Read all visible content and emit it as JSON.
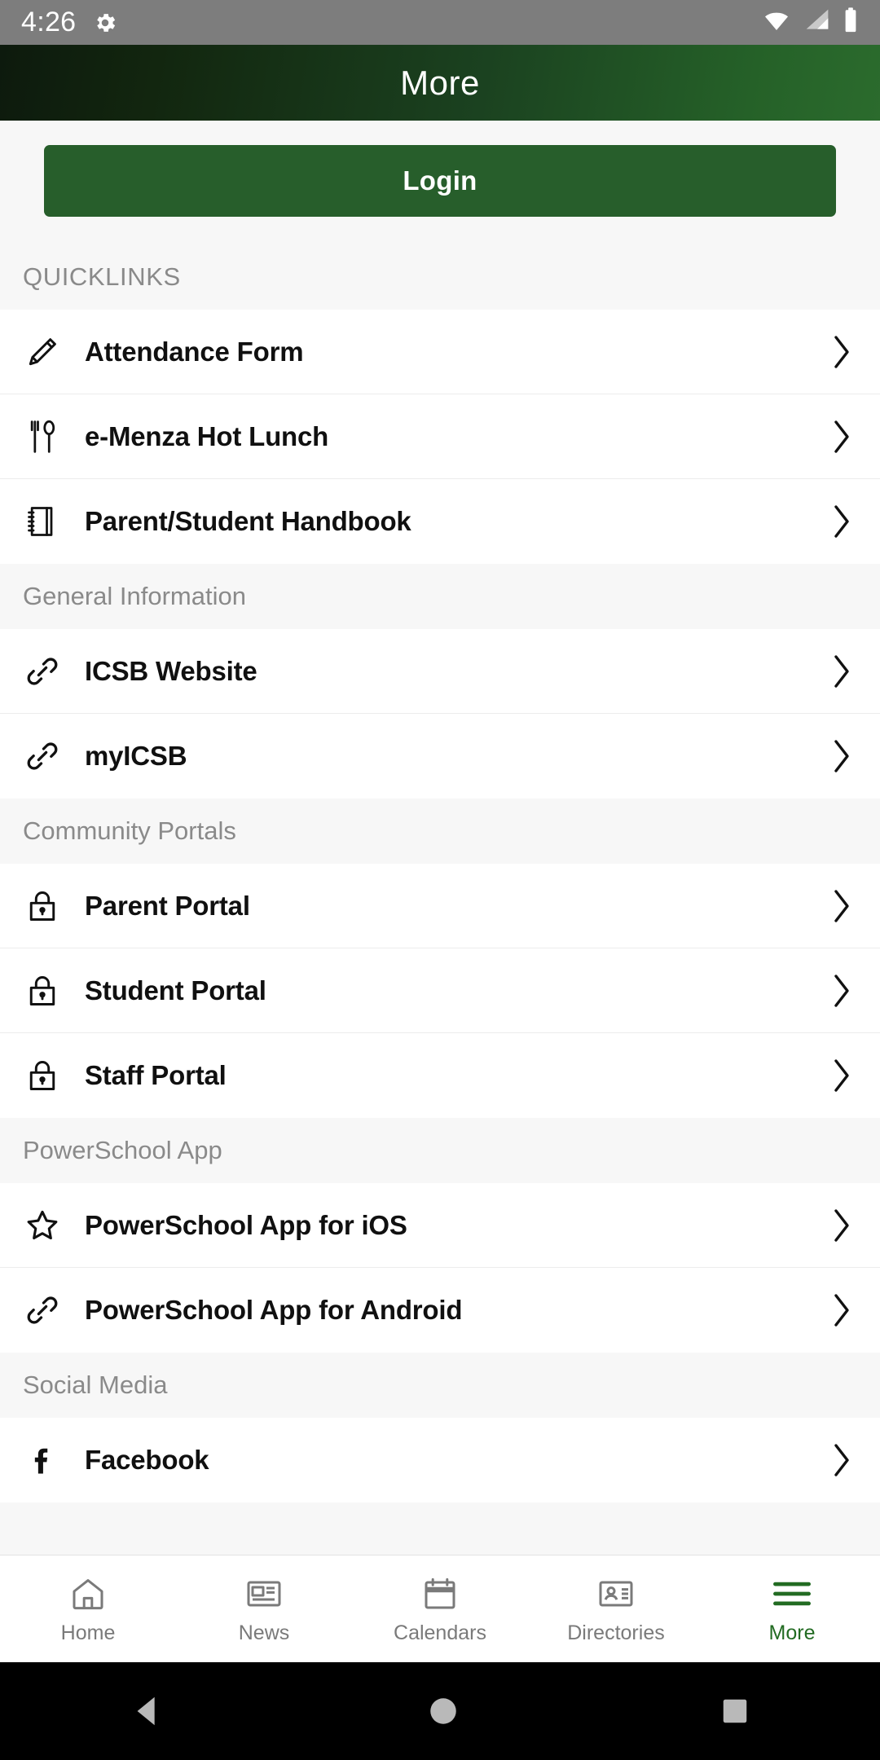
{
  "status_bar": {
    "time": "4:26",
    "icons": [
      "gear-icon",
      "wifi-icon",
      "cellular-signal-icon",
      "battery-icon"
    ]
  },
  "app_bar": {
    "title": "More",
    "background_start": "#0d1a0d",
    "background_end": "#2b6b2d"
  },
  "login": {
    "label": "Login",
    "color": "#275e2b"
  },
  "sections": [
    {
      "title": "QUICKLINKS",
      "items": [
        {
          "label": "Attendance Form",
          "icon": "pencil-icon"
        },
        {
          "label": "e-Menza Hot Lunch",
          "icon": "fork-spoon-icon"
        },
        {
          "label": "Parent/Student Handbook",
          "icon": "notebook-icon"
        }
      ]
    },
    {
      "title": "General Information",
      "items": [
        {
          "label": "ICSB Website",
          "icon": "link-icon"
        },
        {
          "label": "myICSB",
          "icon": "link-icon"
        }
      ]
    },
    {
      "title": "Community Portals",
      "items": [
        {
          "label": "Parent Portal",
          "icon": "lock-icon"
        },
        {
          "label": "Student Portal",
          "icon": "lock-icon"
        },
        {
          "label": "Staff Portal",
          "icon": "lock-icon"
        }
      ]
    },
    {
      "title": "PowerSchool App",
      "items": [
        {
          "label": "PowerSchool App for iOS",
          "icon": "star-icon"
        },
        {
          "label": "PowerSchool App for Android",
          "icon": "link-icon"
        }
      ]
    },
    {
      "title": "Social Media",
      "items": [
        {
          "label": "Facebook",
          "icon": "facebook-icon"
        }
      ]
    }
  ],
  "bottom_nav": {
    "active": "More",
    "active_color": "#226b22",
    "items": [
      {
        "label": "Home",
        "icon": "home-icon"
      },
      {
        "label": "News",
        "icon": "newspaper-icon"
      },
      {
        "label": "Calendars",
        "icon": "calendar-icon"
      },
      {
        "label": "Directories",
        "icon": "contact-card-icon"
      },
      {
        "label": "More",
        "icon": "hamburger-icon"
      }
    ]
  },
  "system_nav": {
    "back": "back-triangle-icon",
    "home": "home-circle-icon",
    "recents": "recents-square-icon"
  }
}
